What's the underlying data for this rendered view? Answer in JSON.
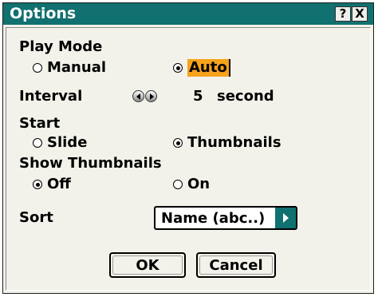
{
  "window": {
    "title": "Options",
    "help_label": "?",
    "close_label": "X"
  },
  "play_mode": {
    "label": "Play Mode",
    "options": [
      "Manual",
      "Auto"
    ],
    "selected": "Auto"
  },
  "interval": {
    "label": "Interval",
    "value": "5",
    "unit": "second"
  },
  "start": {
    "label": "Start",
    "options": [
      "Slide",
      "Thumbnails"
    ],
    "selected": "Thumbnails"
  },
  "show_thumbnails": {
    "label": "Show Thumbnails",
    "options": [
      "Off",
      "On"
    ],
    "selected": "Off"
  },
  "sort": {
    "label": "Sort",
    "value": "Name (abc..)"
  },
  "buttons": {
    "ok": "OK",
    "cancel": "Cancel"
  },
  "colors": {
    "titlebar": "#117070",
    "highlight": "#f6a21a",
    "background": "#f3f2ea"
  }
}
